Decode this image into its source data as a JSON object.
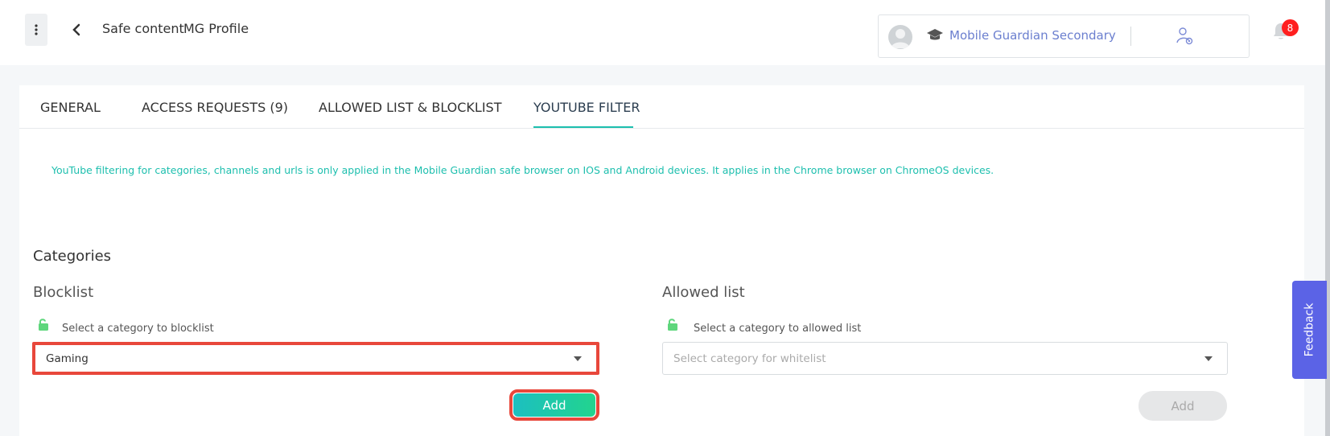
{
  "header": {
    "breadcrumb_1": "Safe content",
    "breadcrumb_2": "MG Profile",
    "school_name": "Mobile Guardian Secondary",
    "notification_count": "8"
  },
  "tabs": [
    {
      "label": "GENERAL"
    },
    {
      "label": "ACCESS REQUESTS (9)"
    },
    {
      "label": "ALLOWED LIST & BLOCKLIST"
    },
    {
      "label": "YOUTUBE FILTER",
      "active": true
    }
  ],
  "notice": "YouTube filtering for categories, channels and urls is only applied in the Mobile Guardian safe browser on IOS and Android devices. It applies in the Chrome browser on ChromeOS devices.",
  "categories": {
    "title": "Categories",
    "blocklist": {
      "title": "Blocklist",
      "field_label": "Select a category to blocklist",
      "value": "Gaming",
      "add_label": "Add"
    },
    "allowed": {
      "title": "Allowed list",
      "field_label": "Select a category to allowed list",
      "placeholder": "Select category for whitelist",
      "add_label": "Add"
    }
  },
  "feedback_label": "Feedback",
  "colors": {
    "accent": "#1dbfae",
    "link": "#6b7fcf",
    "highlight": "#e8473b",
    "feedback": "#5b63e6",
    "badge": "#ff1f1f"
  }
}
